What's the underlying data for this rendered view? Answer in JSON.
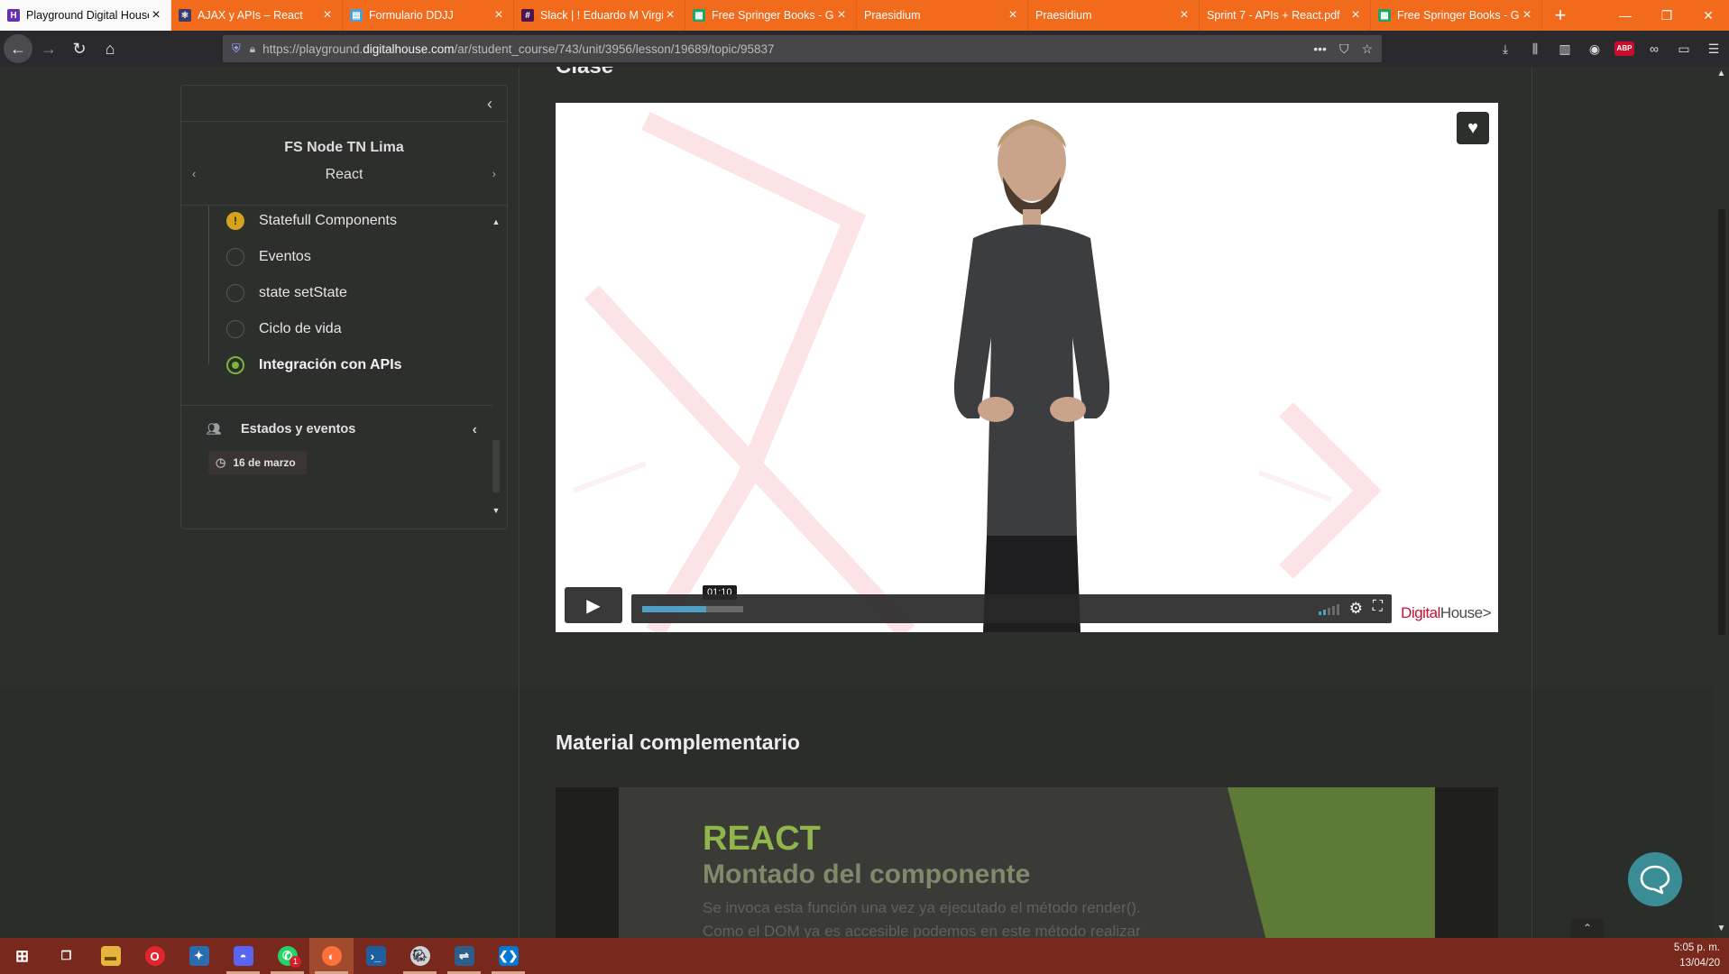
{
  "browser": {
    "tabs": [
      {
        "title": "Playground Digital House",
        "icon": "digitalhouse-icon",
        "color": "#6a2fb0",
        "active": true
      },
      {
        "title": "AJAX y APIs – React",
        "icon": "react-icon",
        "color": "#3b3b6b"
      },
      {
        "title": "Formulario DDJJ",
        "icon": "form-icon",
        "color": "#4a9fd5"
      },
      {
        "title": "Slack | ! Eduardo M Virgi",
        "icon": "slack-icon",
        "color": "#4a154b"
      },
      {
        "title": "Free Springer Books - Go",
        "icon": "sheets-icon",
        "color": "#1fa463"
      },
      {
        "title": "Praesidium",
        "icon": "blank-icon",
        "color": ""
      },
      {
        "title": "Praesidium",
        "icon": "blank-icon",
        "color": ""
      },
      {
        "title": "Sprint 7 - APIs + React.pdf",
        "icon": "blank-icon",
        "color": ""
      },
      {
        "title": "Free Springer Books - Go",
        "icon": "sheets-icon",
        "color": "#1fa463"
      }
    ],
    "url_prefix": "https://playground.",
    "url_host": "digitalhouse.com",
    "url_path": "/ar/student_course/743/unit/3956/lesson/19689/topic/95837"
  },
  "sidebar": {
    "course": "FS Node TN Lima",
    "module": "React",
    "lessons": [
      {
        "label": "Statefull Components",
        "state": "warning"
      },
      {
        "label": "Eventos",
        "state": "pending"
      },
      {
        "label": "state setState",
        "state": "pending"
      },
      {
        "label": "Ciclo de vida",
        "state": "pending"
      },
      {
        "label": "Integración con APIs",
        "state": "current"
      }
    ],
    "unit": "Estados y eventos",
    "date": "16 de marzo"
  },
  "video": {
    "timecode": "01:10",
    "progress_fraction": 0.63,
    "brand_a": "Digital",
    "brand_b": "House",
    "brand_c": ">"
  },
  "material": {
    "title": "Material complementario",
    "slide_title": "REACT",
    "slide_subtitle": "Montado del componente",
    "slide_line1": "Se invoca esta función una vez ya ejecutado el método render().",
    "slide_line2": "Como el DOM ya es accesible podemos en este método realizar"
  },
  "taskbar": {
    "items": [
      "windows-start",
      "task-view",
      "file-explorer",
      "opera-gx",
      "lightbulb-app",
      "discord",
      "whatsapp",
      "firefox",
      "powershell",
      "pgadmin",
      "mysql-workbench",
      "vscode"
    ],
    "whatsapp_badge": "1",
    "time": "5:05 p. m.",
    "date": "13/04/20"
  },
  "colors": {
    "tabbar": "#f26a1b",
    "taskbar": "#78281c",
    "accent_green": "#7ab53c",
    "progress_blue": "#4f9fc4",
    "brand_red": "#c8102e"
  }
}
